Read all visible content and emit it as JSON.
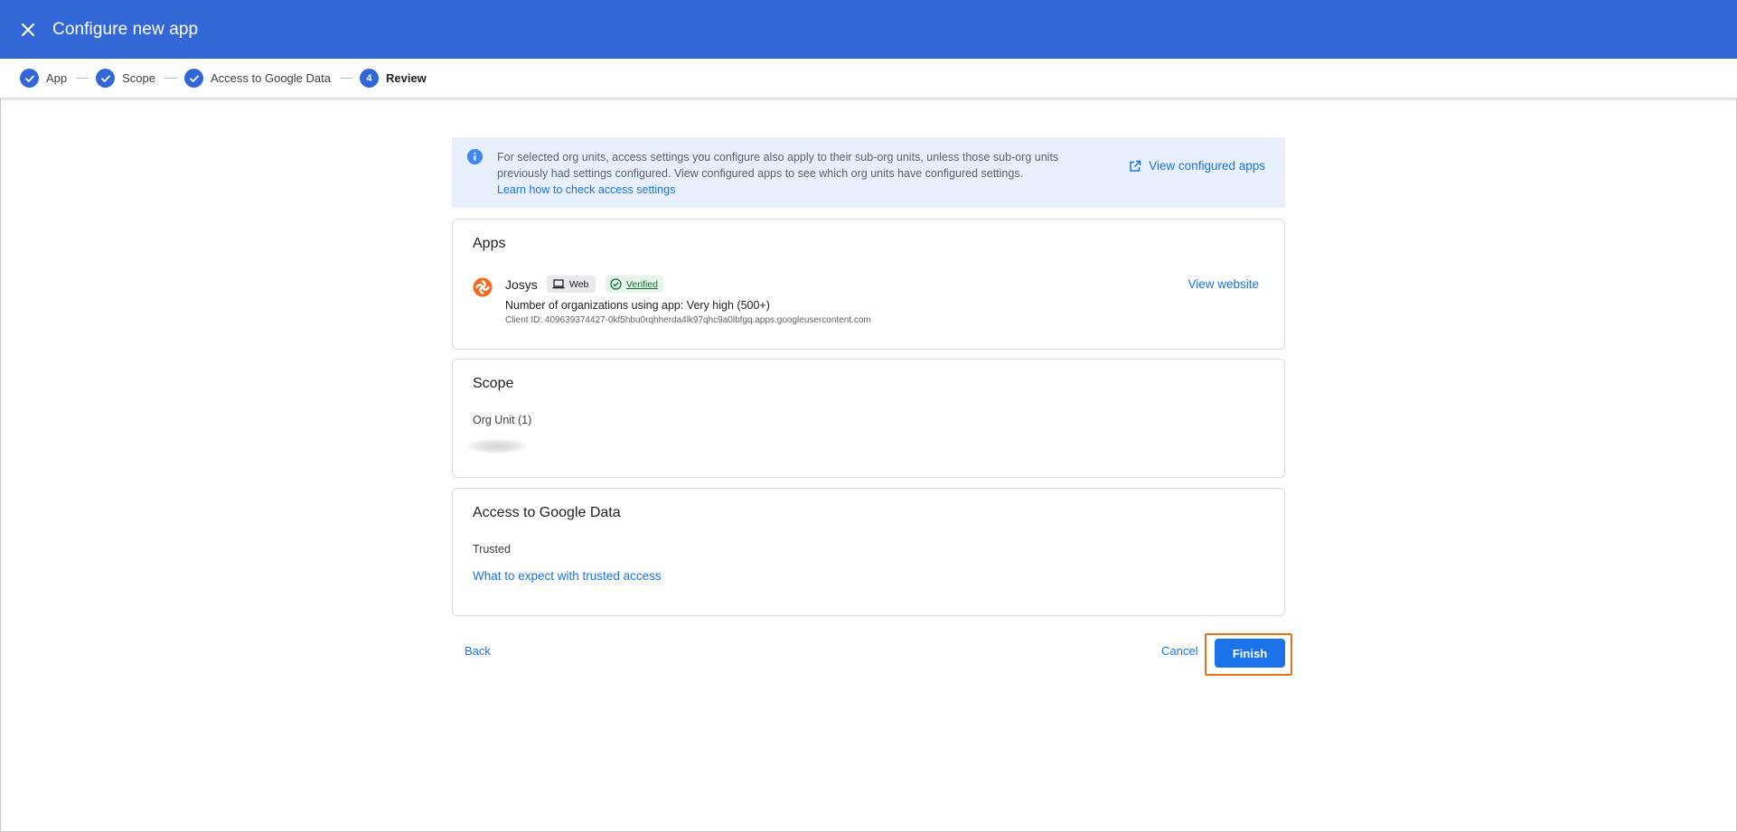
{
  "header": {
    "title": "Configure new app",
    "color": "#3367d6"
  },
  "stepper": {
    "steps": [
      {
        "label": "App",
        "state": "completed"
      },
      {
        "label": "Scope",
        "state": "completed"
      },
      {
        "label": "Access to Google Data",
        "state": "completed"
      },
      {
        "label": "Review",
        "state": "active",
        "number": "4"
      }
    ]
  },
  "info_banner": {
    "text": "For selected org units, access settings you configure also apply to their sub-org units, unless those sub-org units previously had settings configured. View configured apps to see which org units have configured settings.",
    "link": "Learn how to check access settings",
    "action": "View configured apps"
  },
  "apps_card": {
    "title": "Apps",
    "app_name": "Josys",
    "platform_chip": "Web",
    "verified_chip": "Verified",
    "orgs_using": "Number of organizations using app: Very high (500+)",
    "client_id": "Client ID: 409639374427-0kf5hbu0rqhherda4lk97qhc9a0lbfgq.apps.googleusercontent.com",
    "view_website": "View website"
  },
  "scope_card": {
    "title": "Scope",
    "org_unit_label": "Org Unit (1)"
  },
  "access_card": {
    "title": "Access to Google Data",
    "status": "Trusted",
    "link": "What to expect with trusted access"
  },
  "footer": {
    "back": "Back",
    "cancel": "Cancel",
    "finish": "Finish",
    "highlight_color": "#e8711c"
  },
  "icons": [
    "close-icon",
    "check-icon",
    "info-icon",
    "open-in-new-icon",
    "josys-logo",
    "laptop-icon",
    "verified-check-icon"
  ]
}
